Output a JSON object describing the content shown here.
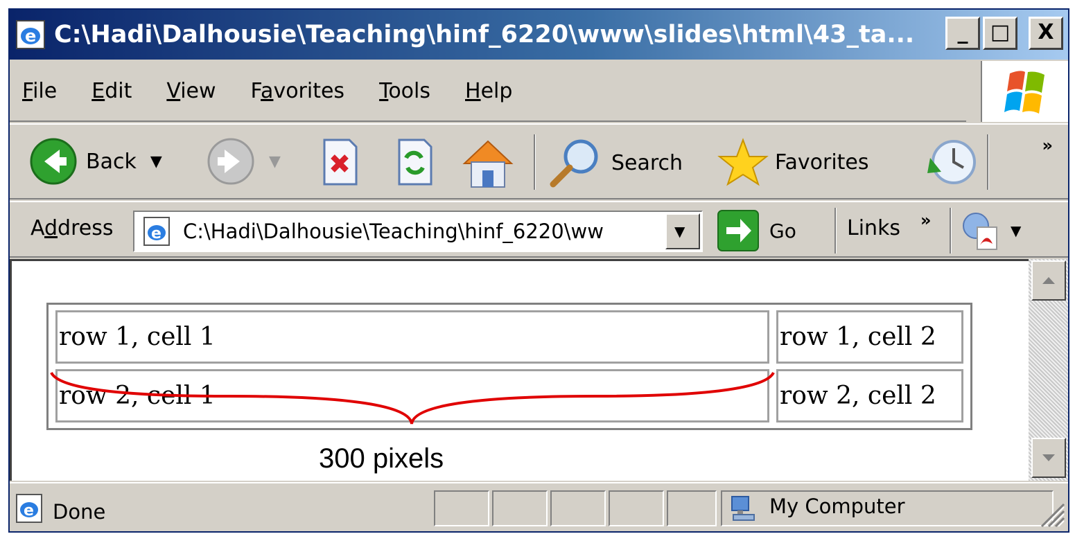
{
  "window": {
    "title": "C:\\Hadi\\Dalhousie\\Teaching\\hinf_6220\\www\\slides\\html\\43_ta...",
    "minimize": "_",
    "maximize": "□",
    "close": "X"
  },
  "menu": {
    "file": "File",
    "edit": "Edit",
    "view": "View",
    "favorites": "Favorites",
    "tools": "Tools",
    "help": "Help"
  },
  "toolbar": {
    "back_label": "Back",
    "search_label": "Search",
    "favorites_label": "Favorites",
    "overflow": "»"
  },
  "address": {
    "label": "Address",
    "value": "C:\\Hadi\\Dalhousie\\Teaching\\hinf_6220\\ww",
    "go_label": "Go",
    "links_label": "Links",
    "overflow": "»"
  },
  "table": {
    "rows": [
      [
        "row 1, cell 1",
        "row 1, cell 2"
      ],
      [
        "row 2, cell 1",
        "row 2, cell 2"
      ]
    ]
  },
  "annotation": {
    "label": "300 pixels",
    "color": "#e00000"
  },
  "status": {
    "text": "Done",
    "zone": "My Computer"
  }
}
